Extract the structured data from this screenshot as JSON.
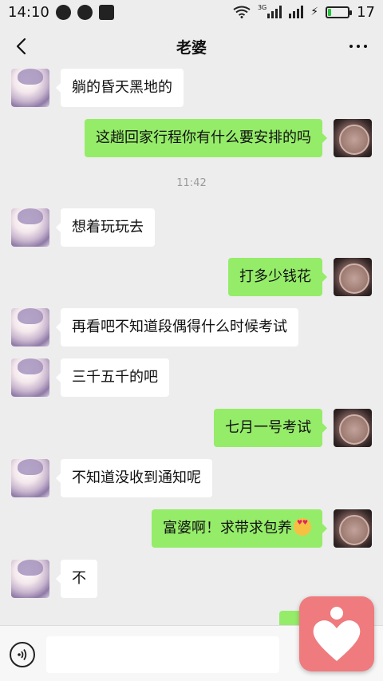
{
  "status_bar": {
    "time": "14:10",
    "network": "3G",
    "battery_text": "17",
    "battery_level": 0.17
  },
  "header": {
    "title": "老婆",
    "back_icon": "chevron-left-icon",
    "more_icon": "more-dots-icon"
  },
  "messages": [
    {
      "side": "left",
      "text": "躺的昏天黑地的"
    },
    {
      "side": "right",
      "text": "这趟回家行程你有什么要安排的吗"
    },
    {
      "timestamp": "11:42"
    },
    {
      "side": "left",
      "text": "想着玩玩去"
    },
    {
      "side": "right",
      "text": "打多少钱花"
    },
    {
      "side": "left",
      "text": "再看吧不知道段偶得什么时候考试"
    },
    {
      "side": "left",
      "text": "三千五千的吧"
    },
    {
      "side": "right",
      "text": "七月一号考试"
    },
    {
      "side": "left",
      "text": "不知道没收到通知呢"
    },
    {
      "side": "right",
      "text": "富婆啊！求带求包养",
      "emoji": "heart-eyes-emoji"
    },
    {
      "side": "left",
      "text": "不"
    }
  ],
  "input": {
    "voice_icon": "voice-icon",
    "value": ""
  },
  "floating_button": {
    "icon": "heart-person-icon",
    "color": "#ef7b7e"
  },
  "colors": {
    "background": "#ededed",
    "my_bubble": "#95ec69",
    "their_bubble": "#ffffff"
  }
}
